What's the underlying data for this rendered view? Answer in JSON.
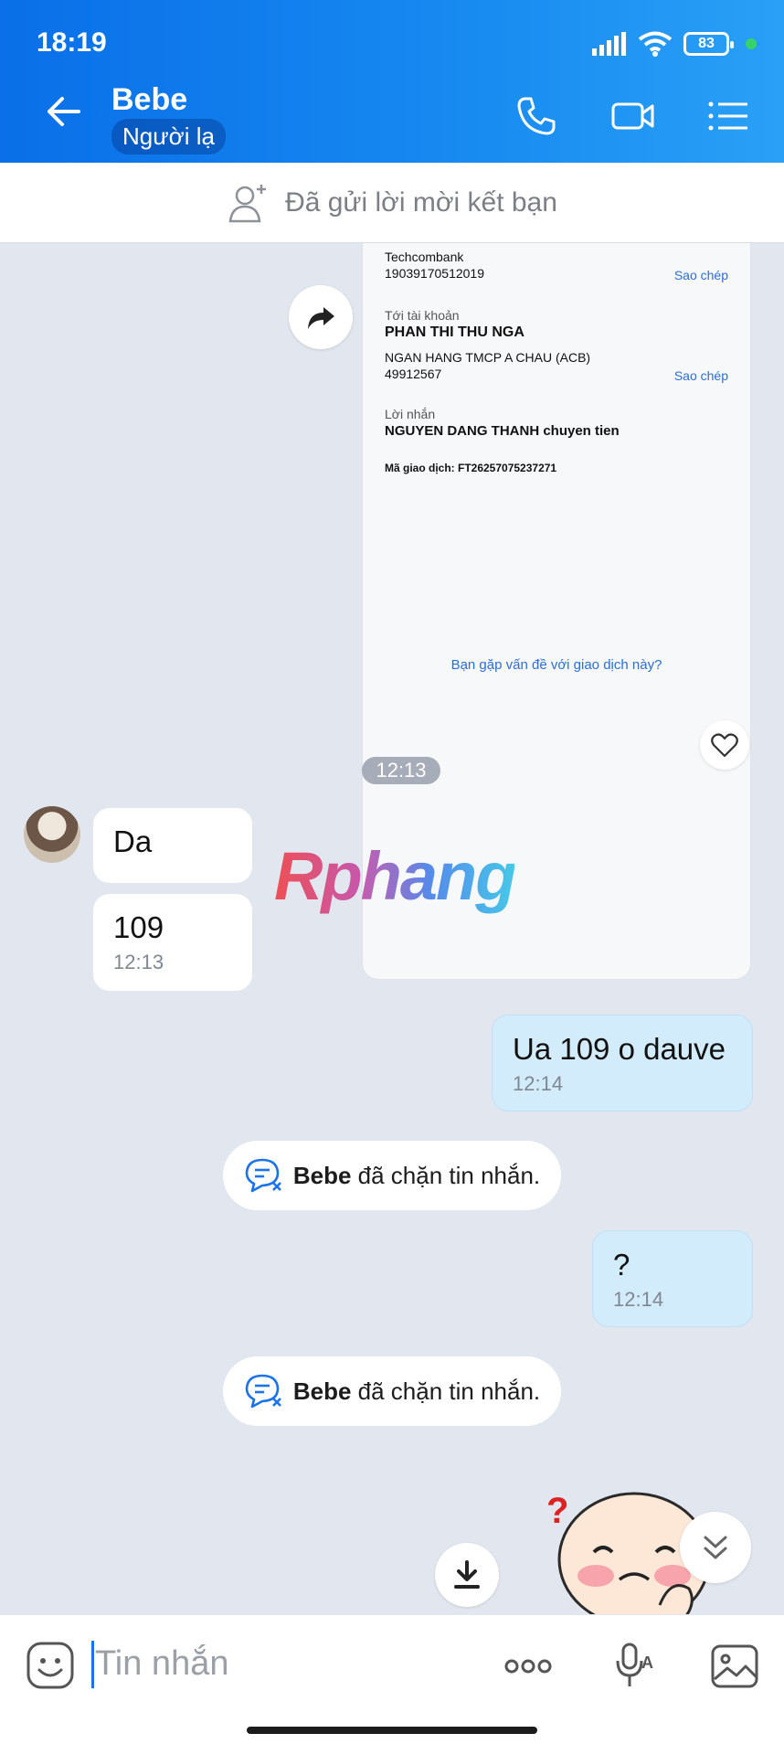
{
  "status_bar": {
    "time": "18:19",
    "battery": "83"
  },
  "header": {
    "contact_name": "Bebe",
    "contact_tag": "Người lạ"
  },
  "friend_request": {
    "text": "Đã gửi lời mời kết bạn"
  },
  "receipt": {
    "bank_name": "Techcombank",
    "from_account": "19039170512019",
    "copy_label": "Sao chép",
    "to_label": "Tới tài khoản",
    "to_name": "PHAN THI THU NGA",
    "to_bank": "NGAN HANG TMCP A CHAU (ACB)",
    "to_account": "49912567",
    "note_label": "Lời nhắn",
    "note_text": "NGUYEN DANG THANH chuyen tien",
    "txn_id": "Mã giao dịch: FT26257075237271",
    "issue_link": "Bạn gặp vấn đề với giao dịch này?"
  },
  "messages": {
    "time_divider": "12:13",
    "in_1": {
      "text": "Da"
    },
    "in_2": {
      "text": "109",
      "time": "12:13"
    },
    "out_1": {
      "text": "Ua 109 o dauve",
      "time": "12:14"
    },
    "system_1": {
      "name": "Bebe",
      "text": "đã chặn tin nhắn."
    },
    "out_2": {
      "text": "?",
      "time": "12:14"
    },
    "system_2": {
      "name": "Bebe",
      "text": "đã chặn tin nhắn."
    }
  },
  "watermark": "Rphang",
  "composer": {
    "placeholder": "Tin nhắn"
  },
  "colors": {
    "header_blue": "#0a6fe8",
    "outgoing_bubble": "#d3ecfc",
    "chat_bg": "#e2e7ef",
    "link_blue": "#2a6fd6"
  }
}
